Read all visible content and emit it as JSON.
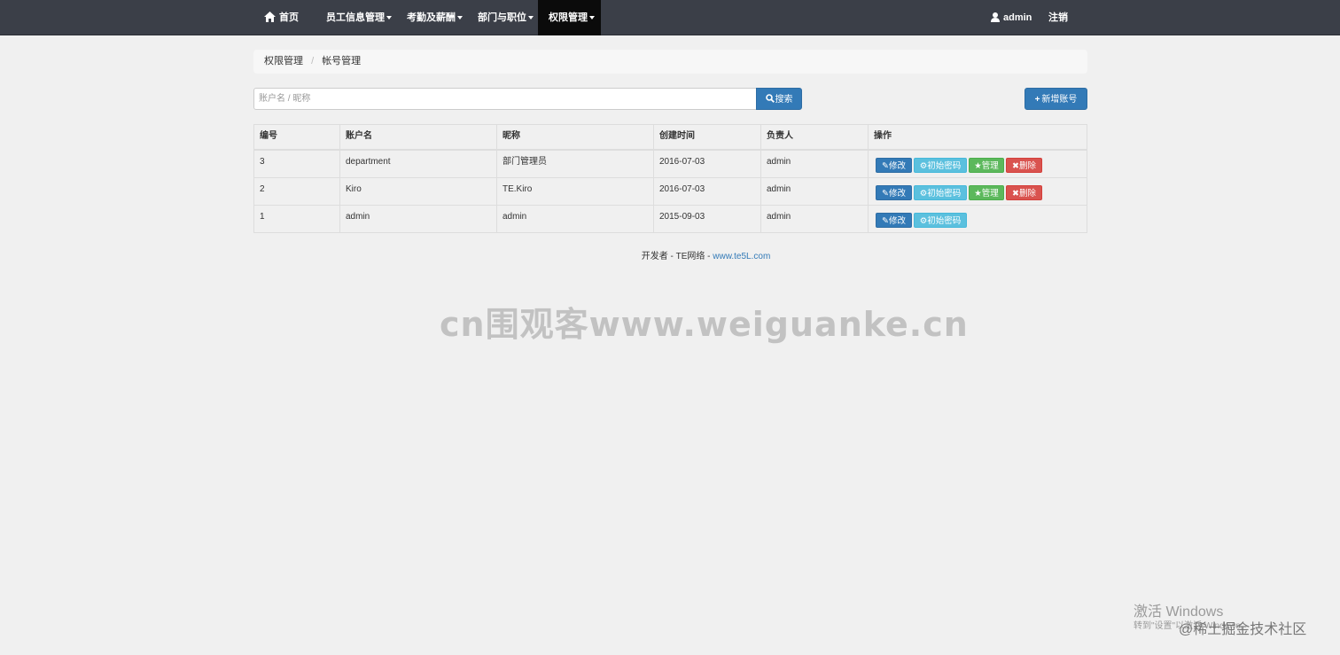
{
  "nav": {
    "home": "首页",
    "items": [
      "员工信息管理",
      "考勤及薪酬",
      "部门与职位",
      "权限管理"
    ],
    "user": "admin",
    "logout": "注销"
  },
  "breadcrumb": {
    "parent": "权限管理",
    "separator": "/",
    "current": "帐号管理"
  },
  "search": {
    "placeholder": "账户名 / 昵称",
    "button": "搜索"
  },
  "add_button": "新增账号",
  "table": {
    "headers": [
      "编号",
      "账户名",
      "昵称",
      "创建时间",
      "负责人",
      "操作"
    ],
    "rows": [
      {
        "id": "3",
        "account": "department",
        "nickname": "部门管理员",
        "created": "2016-07-03",
        "owner": "admin"
      },
      {
        "id": "2",
        "account": "Kiro",
        "nickname": "TE.Kiro",
        "created": "2016-07-03",
        "owner": "admin"
      },
      {
        "id": "1",
        "account": "admin",
        "nickname": "admin",
        "created": "2015-09-03",
        "owner": "admin"
      }
    ],
    "actions": {
      "edit": "修改",
      "reset": "初始密码",
      "manage": "管理",
      "delete": "删除"
    }
  },
  "footer": {
    "text": "开发者 - TE网络 - ",
    "link": "www.te5L.com"
  },
  "watermark": "cn围观客www.weiguanke.cn",
  "windows": {
    "title": "激活 Windows",
    "sub": "转到\"设置\"以激活 Windows。"
  },
  "corner_watermark": "@稀土掘金技术社区",
  "colors": {
    "navbar": "#3b3f48",
    "primary": "#337ab7",
    "info": "#5bc0de",
    "success": "#5cb85c",
    "danger": "#d9534f"
  }
}
